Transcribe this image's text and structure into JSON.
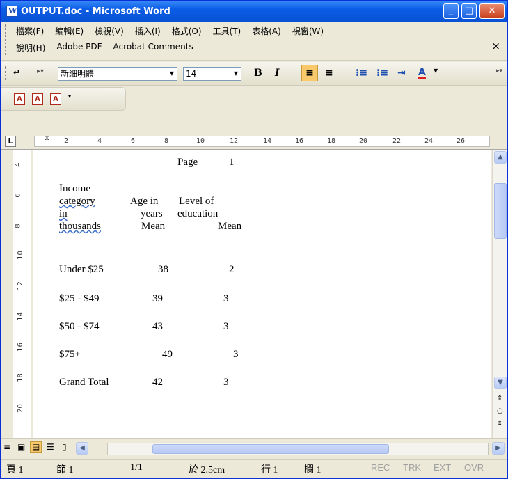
{
  "window": {
    "title": "OUTPUT.doc - Microsoft Word"
  },
  "menu": {
    "row1": [
      "檔案(F)",
      "編輯(E)",
      "檢視(V)",
      "插入(I)",
      "格式(O)",
      "工具(T)",
      "表格(A)",
      "視窗(W)"
    ],
    "row2": [
      "說明(H)",
      "Adobe PDF",
      "Acrobat Comments"
    ]
  },
  "toolbar": {
    "font_name": "新細明體",
    "font_size": "14",
    "bold": "B",
    "italic": "I"
  },
  "ruler": {
    "ticks": [
      "2",
      "4",
      "6",
      "8",
      "10",
      "12",
      "14",
      "16",
      "18",
      "20",
      "22",
      "24",
      "26"
    ]
  },
  "vruler": {
    "ticks": [
      "4",
      "6",
      "8",
      "10",
      "12",
      "14",
      "16",
      "18",
      "20"
    ]
  },
  "document": {
    "page_label": "Page",
    "page_number": "1",
    "col1_header": [
      "Income",
      "category",
      "in",
      "thousands"
    ],
    "col2_header": [
      "Age in",
      "years",
      "Mean"
    ],
    "col3_header": [
      "Level of",
      "education",
      "Mean"
    ],
    "rows": [
      {
        "category": "Under $25",
        "age": "38",
        "edu": "2"
      },
      {
        "category": "$25 - $49",
        "age": "39",
        "edu": "3"
      },
      {
        "category": "$50 - $74",
        "age": "43",
        "edu": "3"
      },
      {
        "category": "$75+",
        "age": "49",
        "edu": "3"
      },
      {
        "category": "Grand Total",
        "age": "42",
        "edu": "3"
      }
    ]
  },
  "status": {
    "page": "頁 1",
    "section": "節 1",
    "pages": "1/1",
    "at": "於 2.5cm",
    "line": "行 1",
    "col": "欄 1",
    "rec": "REC",
    "trk": "TRK",
    "ext": "EXT",
    "ovr": "OVR"
  }
}
